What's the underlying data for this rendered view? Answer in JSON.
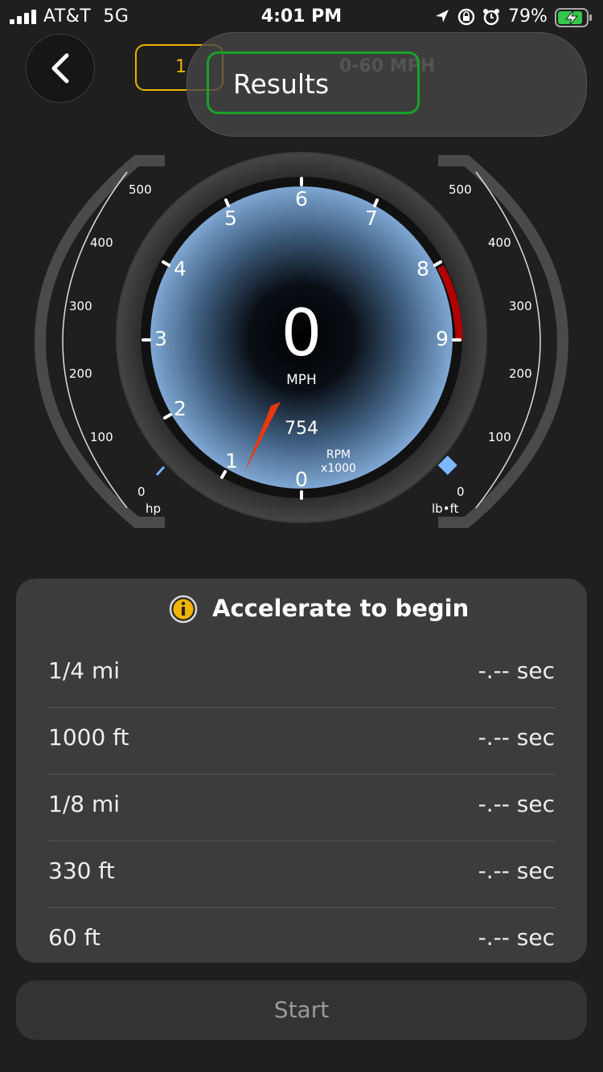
{
  "status": {
    "carrier": "AT&T",
    "network": "5G",
    "time": "4:01 PM",
    "battery": "79%"
  },
  "header": {
    "segment_left_label": "1",
    "dropdown_ghost_label": "0-60 MPH",
    "selected_option": "Results"
  },
  "gauge": {
    "speed_value": "0",
    "speed_unit": "MPH",
    "rpm_value": "754",
    "rpm_unit_line1": "RPM",
    "rpm_unit_line2": "x1000",
    "rpm_ticks": [
      "0",
      "1",
      "2",
      "3",
      "4",
      "5",
      "6",
      "7",
      "8",
      "9"
    ],
    "hp_ticks": [
      "0",
      "100",
      "200",
      "300",
      "400",
      "500"
    ],
    "hp_unit": "hp",
    "torque_ticks": [
      "0",
      "100",
      "200",
      "300",
      "400",
      "500"
    ],
    "torque_unit": "lb•ft",
    "needle_color": "#e8380f",
    "redline_color": "#b00000"
  },
  "results": {
    "title": "Accelerate to begin",
    "rows": [
      {
        "label": "1/4 mi",
        "value": "-.-- sec"
      },
      {
        "label": "1000 ft",
        "value": "-.-- sec"
      },
      {
        "label": "1/8 mi",
        "value": "-.-- sec"
      },
      {
        "label": "330 ft",
        "value": "-.-- sec"
      },
      {
        "label": "60 ft",
        "value": "-.-- sec"
      }
    ]
  },
  "start_label": "Start"
}
